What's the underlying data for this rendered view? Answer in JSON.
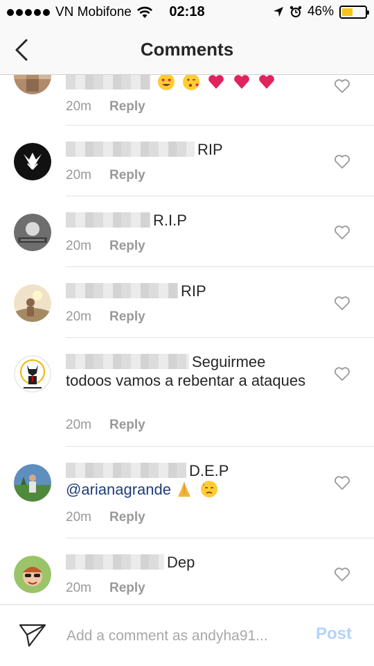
{
  "status_bar": {
    "carrier": "VN Mobifone",
    "time": "02:18",
    "battery": "46%",
    "battery_level": 0.46,
    "battery_color": "#f5c518"
  },
  "nav": {
    "title": "Comments",
    "back_icon": "chevron-left-icon"
  },
  "comments": [
    {
      "text": "",
      "time": "20m",
      "reply": "Reply",
      "emojis": [
        "heart-eyes",
        "kiss",
        "heart",
        "heart",
        "heart"
      ]
    },
    {
      "text": "RIP",
      "time": "20m",
      "reply": "Reply"
    },
    {
      "text": "R.I.P",
      "time": "20m",
      "reply": "Reply"
    },
    {
      "text": "RIP",
      "time": "20m",
      "reply": "Reply"
    },
    {
      "text": "Seguirmee",
      "text2": "todoos vamos a rebentar a ataques",
      "time": "20m",
      "reply": "Reply"
    },
    {
      "text": "D.E.P",
      "mention": "@arianagrande",
      "time": "20m",
      "reply": "Reply",
      "emojis": [
        "folded-hands",
        "downcast-sweat"
      ]
    },
    {
      "text": "Dep",
      "time": "20m",
      "reply": "Reply"
    }
  ],
  "composer": {
    "placeholder": "Add a comment as andyha91...",
    "post_label": "Post",
    "post_color": "#b3d4fb",
    "send_icon": "paper-plane-icon"
  },
  "colors": {
    "mention": "#1f3d7a",
    "meta": "#999999"
  }
}
